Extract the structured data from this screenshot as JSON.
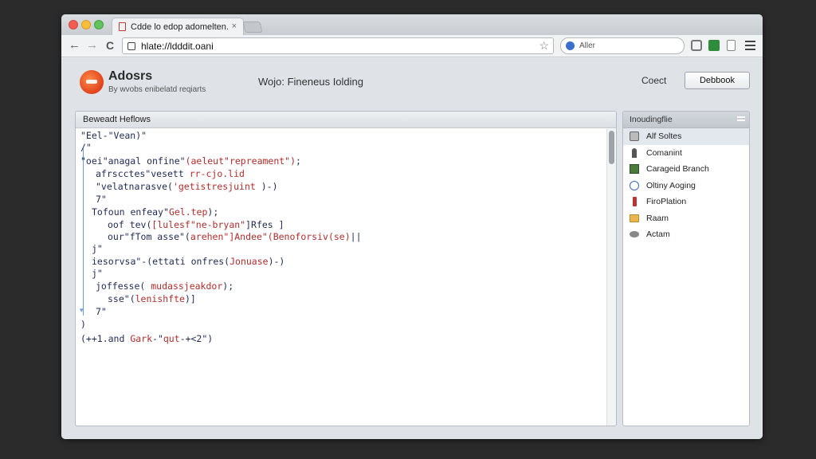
{
  "browser": {
    "tab_title": "Cdde lo edop adomelten.",
    "tab_close": "×",
    "url": "hlate://ldddit.oani",
    "search_placeholder": "Aller",
    "nav_back": "←",
    "nav_forward": "→",
    "nav_reload": "C",
    "bookmark_star": "☆"
  },
  "header": {
    "brand_title": "Adosrs",
    "brand_subtitle": "By wvobs enibelatd reqiarts",
    "page_title": "Wojo: Fineneus Iolding",
    "coect_label": "Coect",
    "action_button": "Debbook"
  },
  "editor": {
    "title": "Beweadt Heflows",
    "lines": [
      {
        "segs": [
          {
            "t": "\"Eel-\"Vean)\"",
            "c": "n"
          }
        ]
      },
      {
        "segs": [
          {
            "t": "/\"",
            "c": "n"
          }
        ]
      },
      {
        "segs": [
          {
            "t": "\"oei\"anagal onfine\"",
            "c": "n"
          },
          {
            "t": "(aeleut\"repreament\")",
            "c": "s"
          },
          {
            "t": ";",
            "c": "n"
          }
        ]
      },
      {
        "segs": [
          {
            "t": "afrscctes\"vesett ",
            "c": "n"
          },
          {
            "t": "rr-cjo.lid",
            "c": "s"
          }
        ]
      },
      {
        "segs": [
          {
            "t": "\"velatnarasve(",
            "c": "n"
          },
          {
            "t": "'getistresjuint",
            "c": "s"
          },
          {
            "t": " )-)",
            "c": "n"
          }
        ]
      },
      {
        "segs": [
          {
            "t": "7\"",
            "c": "n"
          }
        ]
      },
      {
        "segs": [
          {
            "t": "Tofoun enfeay\"",
            "c": "n"
          },
          {
            "t": "Gel.tep",
            "c": "s"
          },
          {
            "t": ");",
            "c": "n"
          }
        ]
      },
      {
        "segs": [
          {
            "t": "oof tev(",
            "c": "n"
          },
          {
            "t": "[lulesf\"ne-bryan\"",
            "c": "s"
          },
          {
            "t": "]Rfes ]",
            "c": "n"
          }
        ]
      },
      {
        "segs": [
          {
            "t": "our\"fTom asse\"(",
            "c": "n"
          },
          {
            "t": "arehen\"]Andee\"(Benoforsiv(se)",
            "c": "s"
          },
          {
            "t": "||",
            "c": "n"
          }
        ]
      },
      {
        "segs": [
          {
            "t": "j\"",
            "c": "n"
          }
        ]
      },
      {
        "segs": [
          {
            "t": "iesorvsa\"-(ettati onfres(",
            "c": "n"
          },
          {
            "t": "Jonuase",
            "c": "s"
          },
          {
            "t": ")-)",
            "c": "n"
          }
        ]
      },
      {
        "segs": [
          {
            "t": "j\"",
            "c": "n"
          }
        ]
      },
      {
        "segs": [
          {
            "t": "joffesse( ",
            "c": "n"
          },
          {
            "t": "mudassjeakdor",
            "c": "s"
          },
          {
            "t": ");",
            "c": "n"
          }
        ]
      },
      {
        "segs": [
          {
            "t": "sse\"(",
            "c": "n"
          },
          {
            "t": "lenishfte",
            "c": "s"
          },
          {
            "t": ")]",
            "c": "n"
          }
        ]
      },
      {
        "segs": [
          {
            "t": "7\"",
            "c": "n"
          }
        ]
      },
      {
        "segs": [
          {
            "t": ")",
            "c": "n"
          }
        ]
      },
      {
        "segs": [
          {
            "t": "(++1.and ",
            "c": "n"
          },
          {
            "t": "Gark",
            "c": "s"
          },
          {
            "t": "-\"",
            "c": "n"
          },
          {
            "t": "qut",
            "c": "s"
          },
          {
            "t": "-+<2\")",
            "c": "n"
          }
        ]
      }
    ]
  },
  "sidebar": {
    "title": "Inoudingflie",
    "items": [
      {
        "label": "Alf Soltes",
        "icon": "folder-search-icon",
        "active": true
      },
      {
        "label": "Comanint",
        "icon": "person-icon",
        "active": false
      },
      {
        "label": "Carageid Branch",
        "icon": "branch-icon",
        "active": false
      },
      {
        "label": "Oltiny Aoging",
        "icon": "globe-icon",
        "active": false
      },
      {
        "label": "FiroPlation",
        "icon": "pin-icon",
        "active": false
      },
      {
        "label": "Raam",
        "icon": "folder-icon",
        "active": false
      },
      {
        "label": "Actam",
        "icon": "bug-icon",
        "active": false
      }
    ]
  },
  "colors": {
    "code_text": "#1f2a55",
    "code_string": "#b22d2d",
    "fold_guide": "#6a9be0",
    "brand_logo": "#e0421a"
  }
}
